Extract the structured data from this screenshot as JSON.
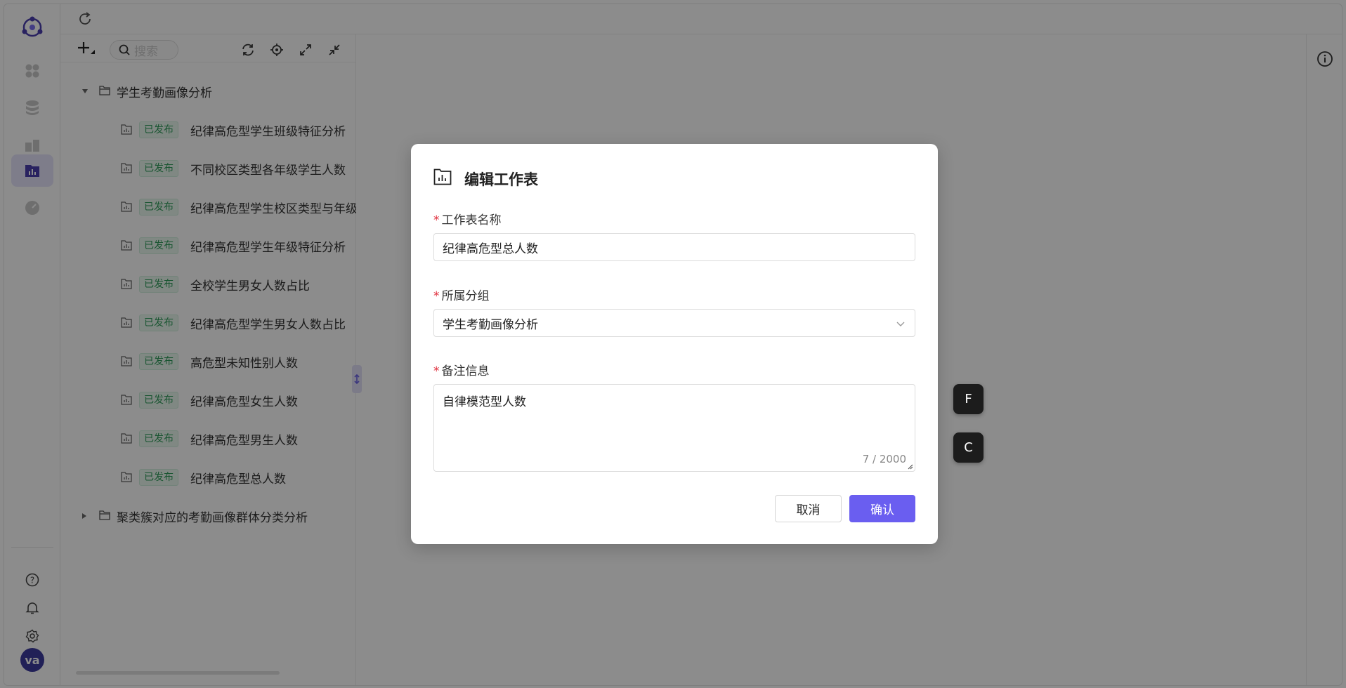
{
  "topbar": {
    "refresh_icon": "refresh-icon"
  },
  "toolbar": {
    "search_placeholder": "搜索",
    "icons": [
      "add-dropdown-icon",
      "search-icon",
      "sync-icon",
      "locate-icon",
      "expand-icon",
      "collapse-icon"
    ]
  },
  "tree": {
    "groups": [
      {
        "label": "学生考勤画像分析",
        "expanded": true
      },
      {
        "label": "聚类簇对应的考勤画像群体分类分析",
        "expanded": false
      }
    ],
    "items": [
      {
        "badge": "已发布",
        "label": "纪律高危型学生班级特征分析"
      },
      {
        "badge": "已发布",
        "label": "不同校区类型各年级学生人数"
      },
      {
        "badge": "已发布",
        "label": "纪律高危型学生校区类型与年级"
      },
      {
        "badge": "已发布",
        "label": "纪律高危型学生年级特征分析"
      },
      {
        "badge": "已发布",
        "label": "全校学生男女人数占比"
      },
      {
        "badge": "已发布",
        "label": "纪律高危型学生男女人数占比"
      },
      {
        "badge": "已发布",
        "label": "高危型未知性别人数"
      },
      {
        "badge": "已发布",
        "label": "纪律高危型女生人数"
      },
      {
        "badge": "已发布",
        "label": "纪律高危型男生人数"
      },
      {
        "badge": "已发布",
        "label": "纪律高危型总人数"
      }
    ]
  },
  "user": {
    "avatar_text": "va"
  },
  "float_buttons": [
    "F",
    "C"
  ],
  "modal": {
    "title": "编辑工作表",
    "required_mark": "*",
    "name_label": "工作表名称",
    "name_value": "纪律高危型总人数",
    "group_label": "所属分组",
    "group_value": "学生考勤画像分析",
    "note_label": "备注信息",
    "note_value": "自律模范型人数",
    "note_count": "7 / 2000",
    "cancel_label": "取消",
    "confirm_label": "确认"
  },
  "colors": {
    "accent": "#6a5ef0",
    "badge_text": "#2f9c5a",
    "badge_bg": "#eaf7ef",
    "required": "#e0303e"
  }
}
